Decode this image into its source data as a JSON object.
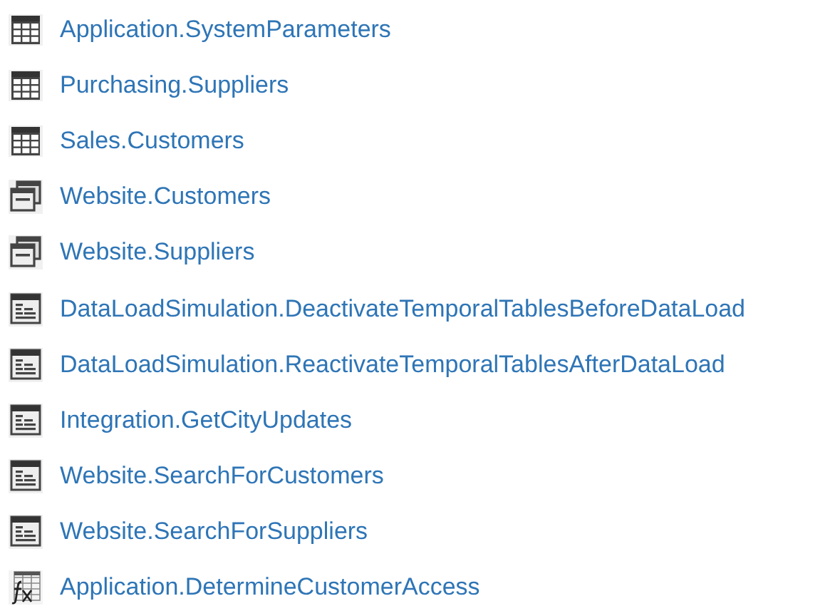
{
  "objects": [
    {
      "kind": "table",
      "name": "Application.SystemParameters"
    },
    {
      "kind": "table",
      "name": "Purchasing.Suppliers"
    },
    {
      "kind": "table",
      "name": "Sales.Customers"
    },
    {
      "kind": "view",
      "name": "Website.Customers"
    },
    {
      "kind": "view",
      "name": "Website.Suppliers"
    },
    {
      "kind": "procedure",
      "name": "DataLoadSimulation.DeactivateTemporalTablesBeforeDataLoad"
    },
    {
      "kind": "procedure",
      "name": "DataLoadSimulation.ReactivateTemporalTablesAfterDataLoad"
    },
    {
      "kind": "procedure",
      "name": "Integration.GetCityUpdates"
    },
    {
      "kind": "procedure",
      "name": "Website.SearchForCustomers"
    },
    {
      "kind": "procedure",
      "name": "Website.SearchForSuppliers"
    },
    {
      "kind": "function",
      "name": "Application.DetermineCustomerAccess"
    }
  ]
}
